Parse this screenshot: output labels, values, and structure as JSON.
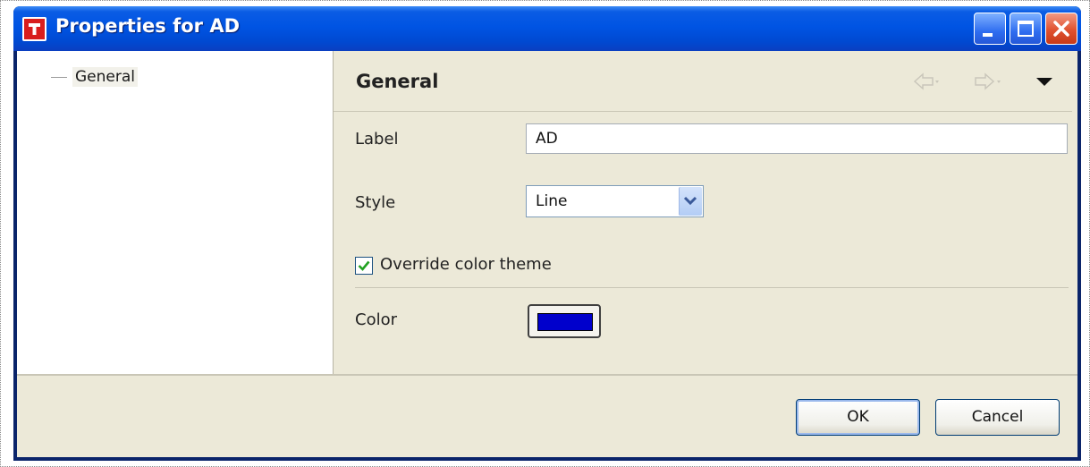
{
  "window": {
    "title": "Properties for AD",
    "icon": "app-red-icon",
    "controls": [
      "minimize-icon",
      "maximize-icon",
      "close-icon"
    ]
  },
  "tree": {
    "items": [
      {
        "label": "General",
        "selected": true
      }
    ]
  },
  "section": {
    "title": "General",
    "nav_icons": [
      "back-arrow-icon",
      "forward-arrow-icon",
      "menu-dropdown-icon"
    ]
  },
  "form": {
    "label_field": {
      "label": "Label",
      "value": "AD"
    },
    "style_field": {
      "label": "Style",
      "value": "Line"
    },
    "override_color_theme": {
      "label": "Override color theme",
      "checked": true
    },
    "color_field": {
      "label": "Color",
      "value": "#0000cc"
    }
  },
  "buttons": {
    "ok": "OK",
    "cancel": "Cancel"
  },
  "colors": {
    "titlebar": "#0054e3",
    "client_bg": "#ece9d8",
    "swatch": "#0000cc"
  }
}
